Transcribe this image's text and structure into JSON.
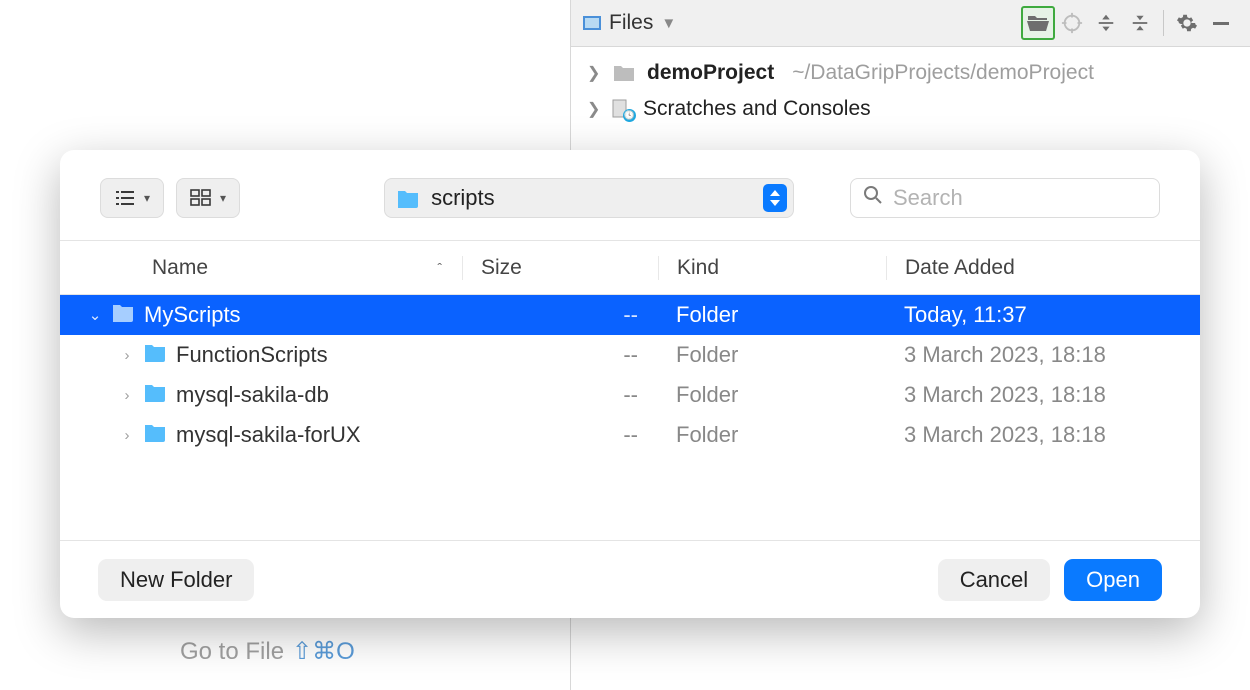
{
  "ide": {
    "files_panel_title": "Files",
    "project_name": "demoProject",
    "project_path": "~/DataGripProjects/demoProject",
    "scratches_label": "Scratches and Consoles",
    "go_to_file_text": "Go to File",
    "go_to_file_shortcut": "⇧⌘O"
  },
  "finder": {
    "breadcrumb": "scripts",
    "search_placeholder": "Search",
    "columns": {
      "name": "Name",
      "size": "Size",
      "kind": "Kind",
      "date": "Date Added"
    },
    "rows": [
      {
        "name": "MyScripts",
        "size": "--",
        "kind": "Folder",
        "date": "Today, 11:37",
        "selected": true,
        "expanded": true,
        "indent": 0
      },
      {
        "name": "FunctionScripts",
        "size": "--",
        "kind": "Folder",
        "date": "3 March 2023, 18:18",
        "selected": false,
        "expanded": false,
        "indent": 1
      },
      {
        "name": "mysql-sakila-db",
        "size": "--",
        "kind": "Folder",
        "date": "3 March 2023, 18:18",
        "selected": false,
        "expanded": false,
        "indent": 1
      },
      {
        "name": "mysql-sakila-forUX",
        "size": "--",
        "kind": "Folder",
        "date": "3 March 2023, 18:18",
        "selected": false,
        "expanded": false,
        "indent": 1
      }
    ],
    "buttons": {
      "new_folder": "New Folder",
      "cancel": "Cancel",
      "open": "Open"
    }
  }
}
